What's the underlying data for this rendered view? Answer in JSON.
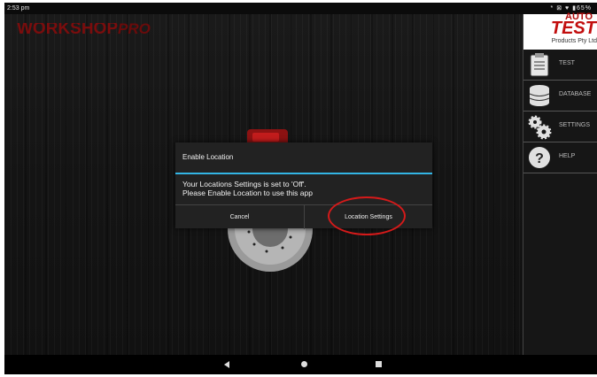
{
  "status_bar": {
    "time": "2:53 pm",
    "right_indicators": "* ⊠ ♥ ▮65%"
  },
  "app": {
    "brand_main": "WORKSHOP",
    "brand_pro": "PRO"
  },
  "side_panel": {
    "logo": {
      "auto": "AUTO",
      "test": "TEST",
      "sub": "Products Pty Ltd"
    },
    "items": [
      {
        "label": "TEST",
        "icon": "clipboard-icon"
      },
      {
        "label": "DATABASE",
        "icon": "database-icon"
      },
      {
        "label": "SETTINGS",
        "icon": "gears-icon"
      },
      {
        "label": "HELP",
        "icon": "help-icon"
      }
    ]
  },
  "dialog": {
    "title": "Enable Location",
    "message_line1": "Your Locations Settings is set to 'Off'.",
    "message_line2": "Please Enable Location to use this app",
    "cancel_label": "Cancel",
    "location_settings_label": "Location Settings",
    "accent_color": "#33b5e5",
    "highlight_color": "#d41a1a"
  },
  "nav_bar": {
    "back": "back-icon",
    "home": "home-icon",
    "recents": "recents-icon"
  }
}
